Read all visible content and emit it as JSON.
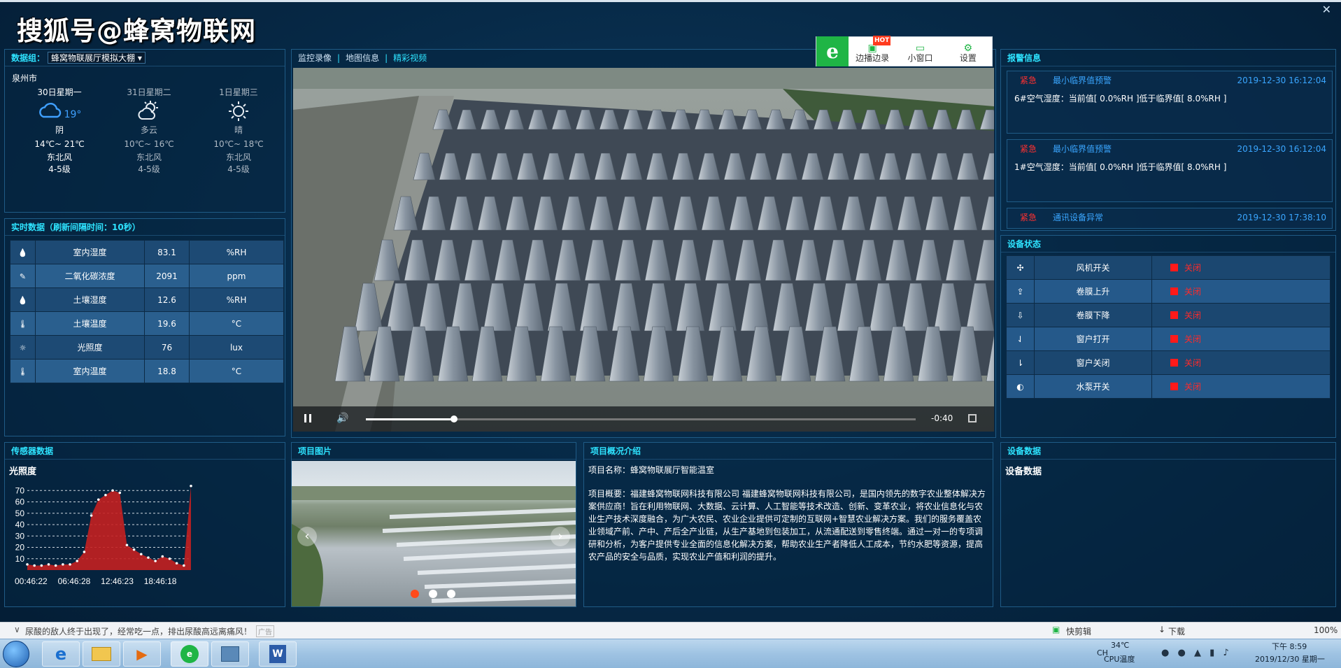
{
  "watermark": "搜狐号@蜂窝物联网",
  "weather": {
    "label": "数据组：",
    "selected_group": "蜂窝物联展厅模拟大棚",
    "city": "泉州市",
    "days": [
      {
        "date": "30日星期一",
        "icon": "cloudy-rain-icon",
        "temp_now": "19°",
        "condition": "阴",
        "range": "14℃~ 21℃",
        "wind_dir": "东北风",
        "wind_level": "4-5级"
      },
      {
        "date": "31日星期二",
        "icon": "partly-cloudy-icon",
        "condition": "多云",
        "range": "10℃~ 16℃",
        "wind_dir": "东北风",
        "wind_level": "4-5级"
      },
      {
        "date": "1日星期三",
        "icon": "sunny-icon",
        "condition": "晴",
        "range": "10℃~ 18℃",
        "wind_dir": "东北风",
        "wind_level": "4-5级"
      }
    ]
  },
  "realtime": {
    "title": "实时数据（刷新间隔时间：10秒）",
    "rows": [
      {
        "icon": "water-drop-icon",
        "name": "室内湿度",
        "value": "83.1",
        "unit": "%RH"
      },
      {
        "icon": "co2-icon",
        "name": "二氧化碳浓度",
        "value": "2091",
        "unit": "ppm"
      },
      {
        "icon": "water-drop-icon",
        "name": "土壤湿度",
        "value": "12.6",
        "unit": "%RH"
      },
      {
        "icon": "thermometer-icon",
        "name": "土壤温度",
        "value": "19.6",
        "unit": "°C"
      },
      {
        "icon": "sun-icon",
        "name": "光照度",
        "value": "76",
        "unit": "lux"
      },
      {
        "icon": "thermometer-icon",
        "name": "室内温度",
        "value": "18.8",
        "unit": "°C"
      }
    ]
  },
  "video": {
    "tabs": [
      "监控录像",
      "地图信息",
      "精彩视频"
    ],
    "active_tab": 2,
    "time_remaining": "-0:40",
    "progress": 0.16
  },
  "browser_toolbar": {
    "items": [
      "边播边录",
      "小窗口",
      "设置"
    ],
    "hot_badge": "HOT"
  },
  "alarms": {
    "title": "报警信息",
    "items": [
      {
        "level": "紧急",
        "type": "最小临界值预警",
        "time": "2019-12-30 16:12:04",
        "message": "6#空气湿度：当前值[ 0.0%RH ]低于临界值[ 8.0%RH ]"
      },
      {
        "level": "紧急",
        "type": "最小临界值预警",
        "time": "2019-12-30 16:12:04",
        "message": "1#空气湿度：当前值[ 0.0%RH ]低于临界值[ 8.0%RH ]"
      },
      {
        "level": "紧急",
        "type": "通讯设备异常",
        "time": "2019-12-30 17:38:10",
        "message": ""
      }
    ]
  },
  "devices": {
    "title": "设备状态",
    "rows": [
      {
        "icon": "fan-icon",
        "name": "风机开关",
        "status": "关闭"
      },
      {
        "icon": "upload-icon",
        "name": "卷膜上升",
        "status": "关闭"
      },
      {
        "icon": "download-icon",
        "name": "卷膜下降",
        "status": "关闭"
      },
      {
        "icon": "sort-asc-icon",
        "name": "窗户打开",
        "status": "关闭"
      },
      {
        "icon": "sort-desc-icon",
        "name": "窗户关闭",
        "status": "关闭"
      },
      {
        "icon": "toggle-icon",
        "name": "水泵开关",
        "status": "关闭"
      }
    ]
  },
  "sensor": {
    "title": "传感器数据",
    "subtitle": "光照度"
  },
  "chart_data": {
    "type": "area",
    "title": "光照度",
    "x_ticks": [
      "00:46:22",
      "06:46:28",
      "12:46:23",
      "18:46:18"
    ],
    "y_ticks": [
      10,
      20,
      30,
      40,
      50,
      60,
      70
    ],
    "ylim": [
      0,
      80
    ],
    "values": [
      5,
      4,
      4,
      5,
      4,
      5,
      5,
      8,
      16,
      48,
      62,
      66,
      70,
      68,
      22,
      18,
      14,
      11,
      8,
      12,
      10,
      6,
      4,
      74
    ],
    "grid": true,
    "color": "#c42020"
  },
  "project_image": {
    "title": "项目图片",
    "slide_count": 3,
    "active_slide": 0
  },
  "intro": {
    "title": "项目概况介绍",
    "name_line": "项目名称：蜂窝物联展厅智能温室",
    "summary": "项目概要：福建蜂窝物联网科技有限公司 福建蜂窝物联网科技有限公司，是国内领先的数字农业整体解决方案供应商！旨在利用物联网、大数据、云计算、人工智能等技术改造、创新、变革农业，将农业信息化与农业生产技术深度融合，为广大农民、农业企业提供可定制的互联网+智慧农业解决方案。我们的服务覆盖农业领域产前、产中、产后全产业链，从生产基地到包装加工，从流通配送到零售终端。通过一对一的专项调研和分析，为客户提供专业全面的信息化解决方案，帮助农业生产者降低人工成本，节约水肥等资源，提高农产品的安全与品质，实现农业产值和利润的提升。"
  },
  "device_data": {
    "title": "设备数据",
    "heading": "设备数据"
  },
  "statusbar": {
    "news": "尿酸的敌人终于出现了，经常吃一点，排出尿酸高远离痛风！",
    "news_badge": "广告",
    "quick_cut": "快剪辑",
    "download": "下载",
    "zoom": "100%"
  },
  "taskbar": {
    "ime": "CH",
    "temp": "34℃",
    "cpu_label": "CPU温度",
    "time": "下午 8:59",
    "date": "2019/12/30 星期一"
  }
}
